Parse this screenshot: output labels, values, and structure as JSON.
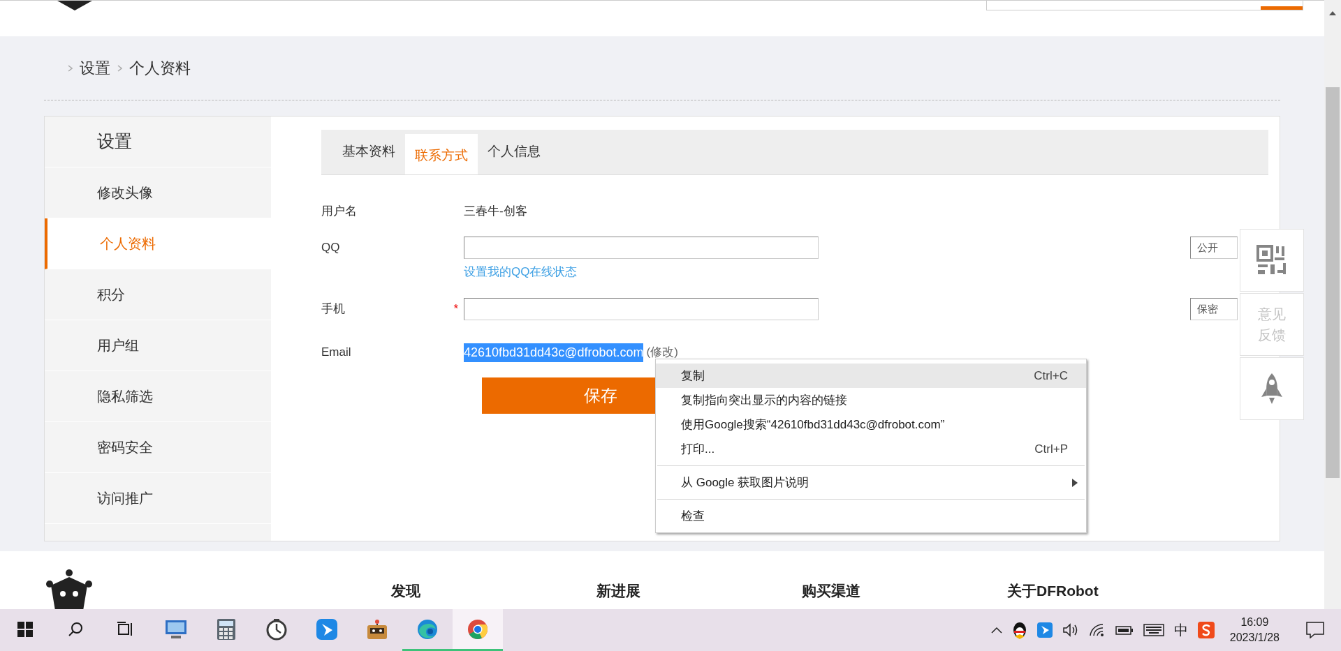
{
  "breadcrumb": [
    "设置",
    "个人资料"
  ],
  "sidebar": {
    "title": "设置",
    "items": [
      {
        "label": "修改头像",
        "selected": false
      },
      {
        "label": "个人资料",
        "selected": true
      },
      {
        "label": "积分",
        "selected": false
      },
      {
        "label": "用户组",
        "selected": false
      },
      {
        "label": "隐私筛选",
        "selected": false
      },
      {
        "label": "密码安全",
        "selected": false
      },
      {
        "label": "访问推广",
        "selected": false
      }
    ]
  },
  "tabs": [
    {
      "label": "基本资料",
      "selected": false
    },
    {
      "label": "联系方式",
      "selected": true
    },
    {
      "label": "个人信息",
      "selected": false
    }
  ],
  "form": {
    "rows": [
      {
        "kind": "text",
        "label": "用户名",
        "value": "三春牛-创客"
      },
      {
        "kind": "input",
        "label": "QQ",
        "link": "设置我的QQ在线状态",
        "privacy": "公开"
      },
      {
        "kind": "input",
        "label": "手机",
        "required_mark": "*",
        "privacy": "保密"
      },
      {
        "kind": "email",
        "label": "Email",
        "value": "42610fbd31dd43c@dfrobot.com",
        "selected": true,
        "action": "(修改)"
      }
    ],
    "save_button": "保存"
  },
  "float_bar": [
    {
      "kind": "qr"
    },
    {
      "kind": "text",
      "label": "意见反馈"
    },
    {
      "kind": "rocket"
    }
  ],
  "context_menu": [
    {
      "kind": "item",
      "label": "复制",
      "shortcut": "Ctrl+C",
      "selected": true
    },
    {
      "kind": "item",
      "label": "复制指向突出显示的内容的链接",
      "selected": false
    },
    {
      "kind": "item",
      "label": "使用Google搜索“42610fbd31dd43c@dfrobot.com”",
      "selected": false
    },
    {
      "kind": "item",
      "label": "打印...",
      "shortcut": "Ctrl+P",
      "selected": false
    },
    {
      "kind": "separator"
    },
    {
      "kind": "submenu",
      "label": "从 Google 获取图片说明",
      "selected": false
    },
    {
      "kind": "separator"
    },
    {
      "kind": "item",
      "label": "检查",
      "selected": false
    }
  ],
  "footer": {
    "columns": [
      "发现",
      "新进展",
      "购买渠道",
      "关于DFRobot"
    ]
  },
  "taskbar": {
    "apps": [
      {
        "kind": "start",
        "running": false,
        "selected": false
      },
      {
        "kind": "search",
        "running": false,
        "selected": false
      },
      {
        "kind": "taskview",
        "running": false,
        "selected": false
      },
      {
        "kind": "remote",
        "running": false,
        "selected": false
      },
      {
        "kind": "calculator",
        "running": false,
        "selected": false
      },
      {
        "kind": "clock",
        "running": false,
        "selected": false
      },
      {
        "kind": "bird",
        "running": false,
        "selected": false
      },
      {
        "kind": "game",
        "running": false,
        "selected": false
      },
      {
        "kind": "edge",
        "running": true,
        "selected": false
      },
      {
        "kind": "chrome",
        "running": true,
        "selected": true
      }
    ],
    "ime": "中",
    "time": "16:09",
    "date": "2023/1/28"
  }
}
